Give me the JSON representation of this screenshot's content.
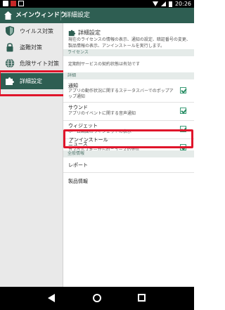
{
  "status_bar": {
    "time": "20:26"
  },
  "app_bar": {
    "nav_title": "メインウィンドウ",
    "page_title": "詳細設定"
  },
  "sidebar": {
    "items": [
      {
        "label": "ウイルス対策",
        "icon": "shield-icon"
      },
      {
        "label": "盗難対策",
        "icon": "lock-icon"
      },
      {
        "label": "危険サイト対策",
        "icon": "globe-icon"
      },
      {
        "label": "詳細設定",
        "icon": "puzzle-icon",
        "active": true
      }
    ]
  },
  "content": {
    "header": {
      "title": "詳細設定",
      "description": "現在のライセンスの情報の表示、通知の設定、暗証番号の変更、製品情報の表示、アンインストールを実行します。"
    },
    "sections": {
      "license": "ライセンス",
      "details": "詳細",
      "other": "全般情報"
    },
    "license_text": "定期制サービスの契約状態は有効です",
    "settings": [
      {
        "title": "通知",
        "subtitle": "アプリの動作状況に関するステータスバーでのポップアップ通知",
        "checked": true
      },
      {
        "title": "サウンド",
        "subtitle": "アプリのイベントに関する音声通知",
        "checked": true
      },
      {
        "title": "ウィジェット",
        "subtitle": "ホーム画面のウィジェットの表示",
        "checked": true
      },
      {
        "title": "ニュース",
        "subtitle": "カスペルスキーからのニュースの受信",
        "checked": true
      }
    ],
    "uninstall_label": "アンインストール",
    "report_label": "レポート",
    "product_info_label": "製品情報"
  },
  "colors": {
    "accent": "#2e5e52",
    "highlight": "#e0152b",
    "check": "#2c8e66"
  }
}
